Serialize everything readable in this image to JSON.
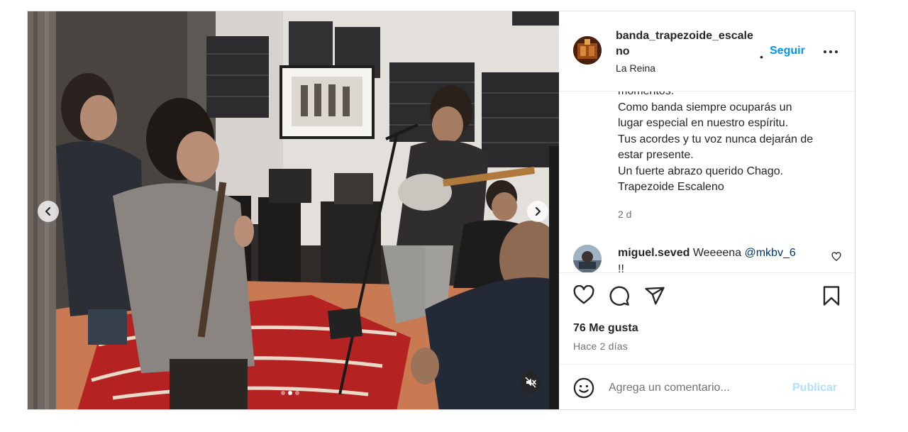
{
  "media": {
    "slides": 3,
    "active_slide": 2
  },
  "header": {
    "username": "banda_trapezoide_escaleno",
    "separator": "•",
    "follow_label": "Seguir",
    "location": "La Reina"
  },
  "caption": {
    "lines": [
      "momentos.",
      "Como banda siempre ocuparás un",
      "lugar especial en nuestro espíritu.",
      "Tus acordes y tu voz nunca dejarán de",
      "estar presente.",
      "Un fuerte abrazo querido Chago.",
      "Trapezoide Escaleno"
    ],
    "time": "2 d"
  },
  "comments": [
    {
      "username": "miguel.seved",
      "text": "Weeeena",
      "mention": "@mkbv_6",
      "after_mention": "!!"
    }
  ],
  "actions": {
    "icons": [
      "heart-icon",
      "comment-icon",
      "share-icon",
      "save-icon"
    ]
  },
  "likes": "76 Me gusta",
  "posted_ago": "Hace 2 días",
  "comment_box": {
    "placeholder": "Agrega un comentario...",
    "publish_label": "Publicar"
  },
  "colors": {
    "accent": "#0095f6",
    "publish_disabled": "#b2dffc",
    "mention": "#00376b",
    "muted_text": "#737373"
  }
}
